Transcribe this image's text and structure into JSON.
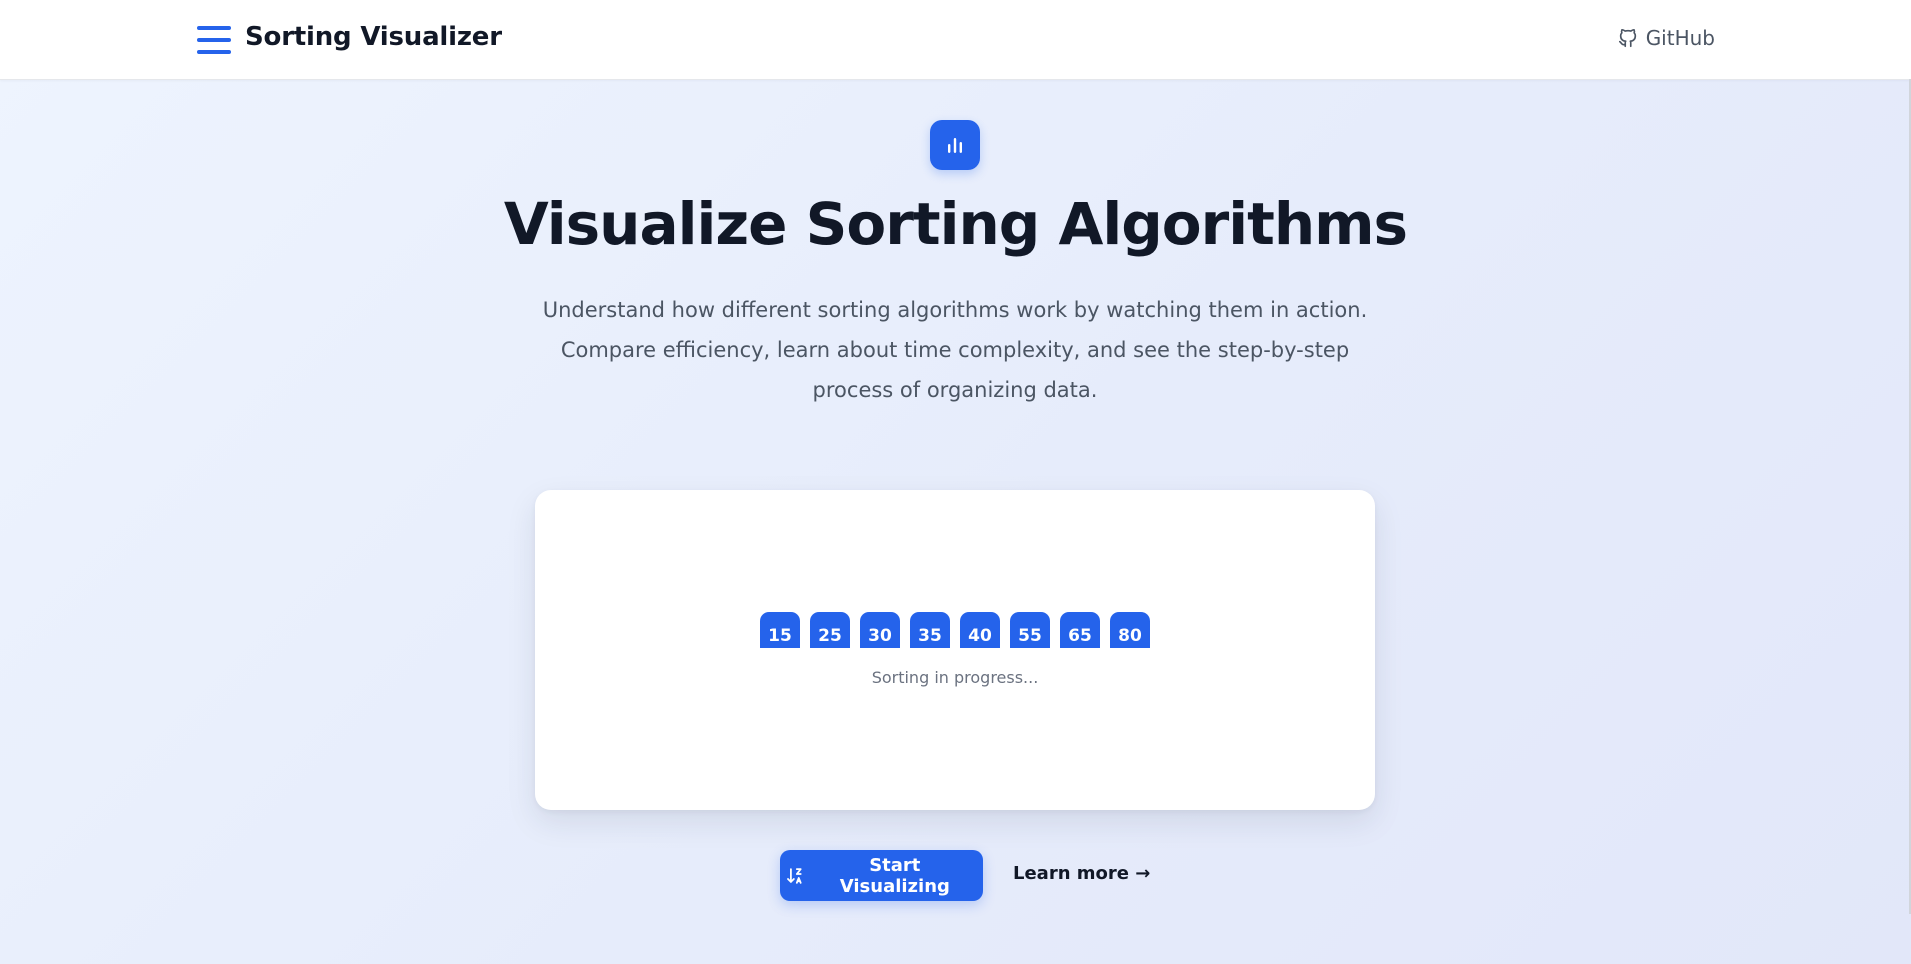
{
  "header": {
    "menu_icon": "hamburger-menu-icon",
    "brand": "Sorting Visualizer",
    "github_label": "GitHub",
    "github_icon": "github-icon"
  },
  "hero": {
    "logo_icon": "bar-chart-icon",
    "title": "Visualize Sorting Algorithms",
    "description": "Understand how different sorting algorithms work by watching them in action. Compare efficiency, learn about time complexity, and see the step-by-step process of organizing data."
  },
  "demo": {
    "values": [
      "15",
      "25",
      "30",
      "35",
      "40",
      "55",
      "65",
      "80"
    ],
    "status": "Sorting in progress..."
  },
  "actions": {
    "primary_label": "Start Visualizing",
    "primary_icon": "sort-ascending-icon",
    "secondary_label": "Learn more →"
  },
  "colors": {
    "accent": "#2563eb",
    "heading": "#111827",
    "body_text": "#4b5563"
  }
}
